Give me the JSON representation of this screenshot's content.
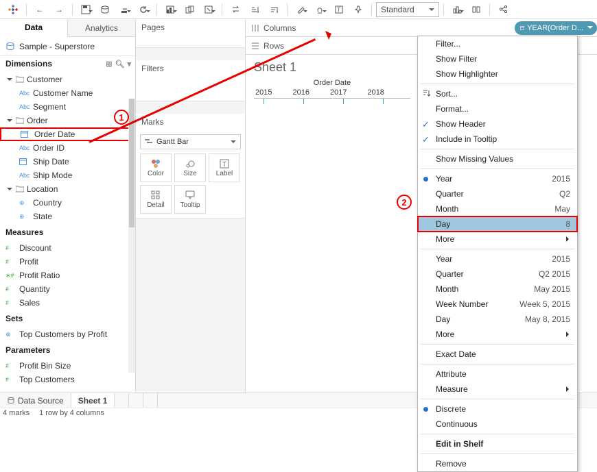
{
  "toolbar": {
    "preset": "Standard"
  },
  "tabs": {
    "data": "Data",
    "analytics": "Analytics"
  },
  "datasource": {
    "name": "Sample - Superstore"
  },
  "sections": {
    "dimensions": "Dimensions",
    "measures": "Measures",
    "sets": "Sets",
    "parameters": "Parameters"
  },
  "dim": {
    "customer": "Customer",
    "customer_name": "Customer Name",
    "segment": "Segment",
    "order": "Order",
    "order_date": "Order Date",
    "order_id": "Order ID",
    "ship_date": "Ship Date",
    "ship_mode": "Ship Mode",
    "location": "Location",
    "country": "Country",
    "state": "State"
  },
  "meas": {
    "discount": "Discount",
    "profit": "Profit",
    "profit_ratio": "Profit Ratio",
    "quantity": "Quantity",
    "sales": "Sales"
  },
  "sets": {
    "top_customers": "Top Customers by Profit"
  },
  "params": {
    "profit_bin": "Profit Bin Size",
    "top_customers": "Top Customers"
  },
  "cards": {
    "pages": "Pages",
    "filters": "Filters",
    "marks": "Marks",
    "mark_type": "Gantt Bar",
    "color": "Color",
    "size": "Size",
    "label": "Label",
    "detail": "Detail",
    "tooltip": "Tooltip"
  },
  "shelves": {
    "columns": "Columns",
    "rows": "Rows",
    "pill": "YEAR(Order D..."
  },
  "sheet": {
    "title": "Sheet 1",
    "axis_title": "Order Date",
    "years": [
      "2015",
      "2016",
      "2017",
      "2018"
    ]
  },
  "chart_data": {
    "type": "bar",
    "title": "Sheet 1",
    "xlabel": "Order Date",
    "categories": [
      "2015",
      "2016",
      "2017",
      "2018"
    ],
    "values": [
      null,
      null,
      null,
      null
    ]
  },
  "menu": {
    "filter": "Filter...",
    "show_filter": "Show Filter",
    "show_highlighter": "Show Highlighter",
    "sort": "Sort...",
    "format": "Format...",
    "show_header": "Show Header",
    "include_tooltip": "Include in Tooltip",
    "show_missing": "Show Missing Values",
    "year": "Year",
    "year_v": "2015",
    "quarter": "Quarter",
    "quarter_v": "Q2",
    "month": "Month",
    "month_v": "May",
    "day": "Day",
    "day_v": "8",
    "more": "More",
    "year2": "Year",
    "year2_v": "2015",
    "quarter2": "Quarter",
    "quarter2_v": "Q2 2015",
    "month2": "Month",
    "month2_v": "May 2015",
    "week_num": "Week Number",
    "week_num_v": "Week 5, 2015",
    "day2": "Day",
    "day2_v": "May 8, 2015",
    "more2": "More",
    "exact": "Exact Date",
    "attribute": "Attribute",
    "measure": "Measure",
    "discrete": "Discrete",
    "continuous": "Continuous",
    "edit_shelf": "Edit in Shelf",
    "remove": "Remove"
  },
  "bottom": {
    "data_source": "Data Source",
    "sheet1": "Sheet 1"
  },
  "status": {
    "marks": "4 marks",
    "rows": "1 row by 4 columns"
  },
  "ann": {
    "n1": "1",
    "n2": "2"
  }
}
